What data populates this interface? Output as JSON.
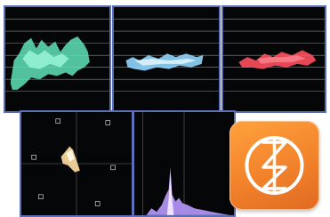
{
  "product": {
    "name": "",
    "icon": "scope-glyph-icon",
    "accent_color": "#f2822b",
    "border_color": "#5a6fb6"
  },
  "scopes": {
    "waveform_luma": {
      "trace_color": "#5fe3b8",
      "grid_values": [
        "100",
        "75",
        "50",
        "25",
        "0"
      ]
    },
    "waveform_cb": {
      "trace_color": "#8fd6ff",
      "grid_values": [
        "100",
        "75",
        "50",
        "25",
        "0"
      ]
    },
    "waveform_cr": {
      "trace_color": "#ff4f5e",
      "grid_values": [
        "100",
        "75",
        "50",
        "25",
        "0"
      ]
    },
    "vectorscope": {
      "trace_color": "#f4d59a",
      "targets": [
        "R",
        "Mg",
        "B",
        "Yl",
        "G",
        "Cy"
      ]
    },
    "histogram": {
      "trace_color": "#b999ff"
    }
  }
}
